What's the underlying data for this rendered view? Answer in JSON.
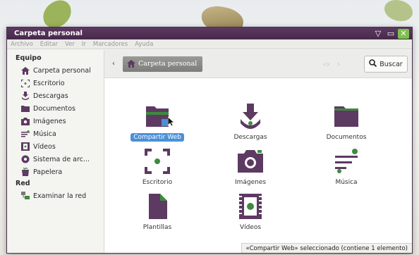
{
  "window": {
    "title": "Carpeta personal",
    "controls": {
      "minimize": "▽",
      "maximize": "▭",
      "close": "✕"
    }
  },
  "menubar": [
    "Archivo",
    "Editar",
    "Ver",
    "Ir",
    "Marcadores",
    "Ayuda"
  ],
  "sidebar": {
    "sections": [
      {
        "title": "Equipo",
        "items": [
          {
            "label": "Carpeta personal",
            "icon": "home-icon"
          },
          {
            "label": "Escritorio",
            "icon": "desktop-icon"
          },
          {
            "label": "Descargas",
            "icon": "download-icon"
          },
          {
            "label": "Documentos",
            "icon": "folder-icon"
          },
          {
            "label": "Imágenes",
            "icon": "camera-icon"
          },
          {
            "label": "Música",
            "icon": "music-icon"
          },
          {
            "label": "Vídeos",
            "icon": "film-icon"
          },
          {
            "label": "Sistema de arc...",
            "icon": "disk-icon"
          },
          {
            "label": "Papelera",
            "icon": "trash-icon"
          }
        ]
      },
      {
        "title": "Red",
        "items": [
          {
            "label": "Examinar la red",
            "icon": "network-icon"
          }
        ]
      }
    ]
  },
  "toolbar": {
    "breadcrumb": "Carpeta personal",
    "search_label": "Buscar"
  },
  "files": [
    {
      "label": "Compartir Web",
      "icon": "share-web-folder-icon",
      "selected": true
    },
    {
      "label": "Descargas",
      "icon": "download-folder-icon",
      "selected": false
    },
    {
      "label": "Documentos",
      "icon": "documents-folder-icon",
      "selected": false
    },
    {
      "label": "Escritorio",
      "icon": "desktop-folder-icon",
      "selected": false
    },
    {
      "label": "Imágenes",
      "icon": "pictures-folder-icon",
      "selected": false
    },
    {
      "label": "Música",
      "icon": "music-folder-icon",
      "selected": false
    },
    {
      "label": "Plantillas",
      "icon": "templates-folder-icon",
      "selected": false
    },
    {
      "label": "Vídeos",
      "icon": "videos-folder-icon",
      "selected": false
    }
  ],
  "status": "«Compartir Web» seleccionado (contiene 1 elemento)",
  "colors": {
    "titlebar": "#5d3a61",
    "icon_purple": "#5d3a61",
    "icon_green": "#3f8a3f",
    "selection": "#4a90d9",
    "close_button": "#7cc04b"
  }
}
